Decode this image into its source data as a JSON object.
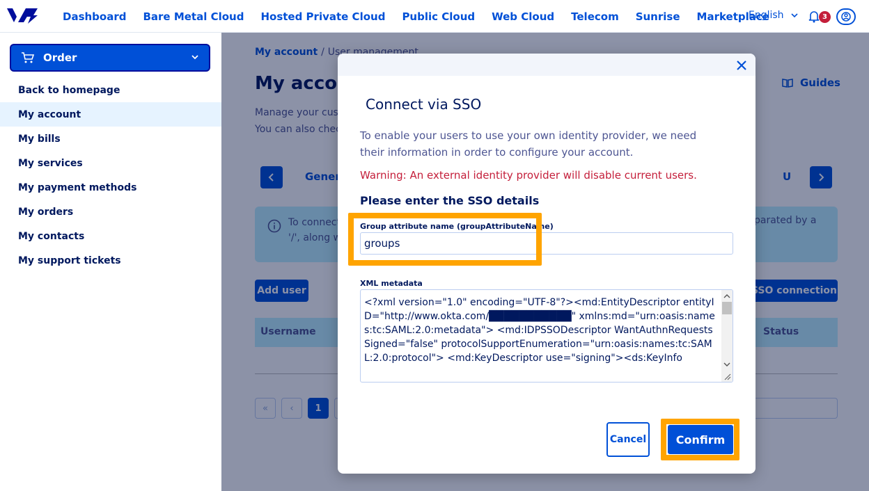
{
  "nav": {
    "items": [
      "Dashboard",
      "Bare Metal Cloud",
      "Hosted Private Cloud",
      "Public Cloud",
      "Web Cloud",
      "Telecom",
      "Sunrise",
      "Marketplace"
    ],
    "language": "English",
    "notifications_count": "3"
  },
  "sidebar": {
    "order_label": "Order",
    "items": [
      "Back to homepage",
      "My account",
      "My bills",
      "My services",
      "My payment methods",
      "My orders",
      "My contacts",
      "My support tickets"
    ],
    "active_index": 1
  },
  "main": {
    "breadcrumb_root": "My account",
    "breadcrumb_sep": "/",
    "breadcrumb_current": "User management",
    "title": "My accoun",
    "desc_line1": "Manage your custo",
    "desc_line2": "You can also check",
    "guides_label": "Guides",
    "tab_general": "Genera",
    "tab_user": "U",
    "info_line1": "To connect",
    "info_line2": "'/', along w",
    "info_right": "parated by a",
    "add_user_label": "Add user",
    "sso_connection_label": "SSO connection",
    "col_username": "Username",
    "col_status": "Status",
    "pagination": [
      "«",
      "‹",
      "1"
    ]
  },
  "modal": {
    "title": "Connect via SSO",
    "description": "To enable your users to use your own identity provider, we need their information in order to configure your account.",
    "warning": "Warning: An external identity provider will disable current users.",
    "subheading": "Please enter the SSO details",
    "group_attr_label": "Group attribute name (groupAttributeName)",
    "group_attr_value": "groups",
    "xml_label": "XML metadata",
    "xml_value": "<?xml version=\"1.0\" encoding=\"UTF-8\"?><md:EntityDescriptor entityID=\"http://www.okta.com/███████████\" xmlns:md=\"urn:oasis:names:tc:SAML:2.0:metadata\"> <md:IDPSSODescriptor WantAuthnRequestsSigned=\"false\" protocolSupportEnumeration=\"urn:oasis:names:tc:SAML:2.0:protocol\"> <md:KeyDescriptor use=\"signing\"><ds:KeyInfo",
    "cancel_label": "Cancel",
    "confirm_label": "Confirm"
  },
  "colors": {
    "brand": "#0050d7",
    "navy": "#00185e",
    "warning": "#c41e3a",
    "highlight": "#ffa400",
    "info_bg": "#bef1ff"
  }
}
